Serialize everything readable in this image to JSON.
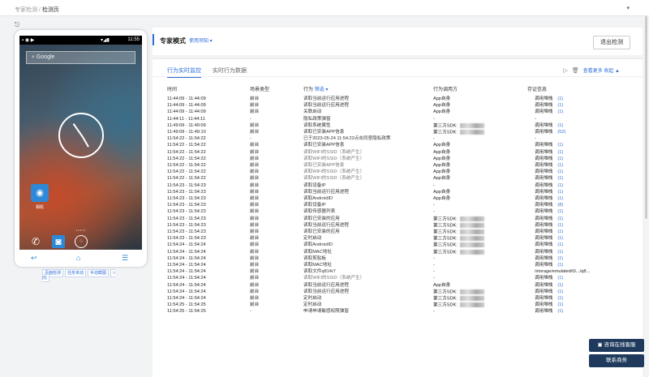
{
  "breadcrumb": {
    "parent": "专家检测",
    "sep": " / ",
    "current": "检测页"
  },
  "user": "▾",
  "phone": {
    "time": "11:55",
    "search": "Google",
    "app_label": "相机",
    "tools": [
      "页面检测",
      "任务未动",
      "手动截图",
      "□ [0]"
    ]
  },
  "header": {
    "mode": "专家模式",
    "howto": "使用须知 ▾",
    "exit": "退出检测"
  },
  "tabs": {
    "active": "行为实时监控",
    "other": "实时行为数据",
    "more": "查看更多",
    "collapse": "收起 ▲"
  },
  "table_header": {
    "time": "时间",
    "scene": "场景类型",
    "behavior": "行为",
    "filter": "筛选 ▾",
    "caller": "行为调用方",
    "evidence": "存证信息"
  },
  "rows": [
    {
      "t": "11:44:09 - 11:44:09",
      "s": "前台",
      "b": "读取当前运行应用进程",
      "c": "App自身",
      "e": "调用堆栈",
      "n": "(1)"
    },
    {
      "t": "11:44:09 - 11:44:09",
      "s": "前台",
      "b": "读取当前运行应用进程",
      "c": "App自身",
      "e": "调用堆栈",
      "n": "(1)"
    },
    {
      "t": "11:44:09 - 11:44:09",
      "s": "前台",
      "b": "关联启动",
      "c": "App自身",
      "e": "调用堆栈",
      "n": "(1)"
    },
    {
      "t": "11:44:11 - 11:44:11",
      "s": "-",
      "b": "隐私政策弹窗",
      "c": "-",
      "e": "-",
      "n": ""
    },
    {
      "t": "11:49:09 - 11:49:09",
      "s": "前台",
      "b": "读取系统属性",
      "c": "第三方SDK:",
      "e": "调用堆栈",
      "n": "(1)"
    },
    {
      "t": "11:49:09 - 11:49:10",
      "s": "前台",
      "b": "读取已安装APP信息",
      "c": "第三方SDK:",
      "e": "调用堆栈",
      "n": "(52)"
    },
    {
      "t": "11:54:22 - 11:54:22",
      "s": "-",
      "b": "已于2023-05-24 11:54:22点击同意隐私政策",
      "c": "-",
      "e": "-",
      "n": ""
    },
    {
      "t": "11:54:22 - 11:54:22",
      "s": "前台",
      "b": "读取已安装APP信息",
      "c": "App自身",
      "e": "调用堆栈",
      "n": "(1)"
    },
    {
      "t": "11:54:22 - 11:54:22",
      "s": "前台",
      "b": "读取WIFI的SSID（系统产生）",
      "c": "App自身",
      "e": "调用堆栈",
      "n": "(1)"
    },
    {
      "t": "11:54:22 - 11:54:22",
      "s": "前台",
      "b": "读取WIFI的SSID（系统产生）",
      "c": "App自身",
      "e": "调用堆栈",
      "n": "(1)"
    },
    {
      "t": "11:54:22 - 11:54:22",
      "s": "前台",
      "b": "读取已安装APP信息",
      "c": "App自身",
      "e": "调用堆栈",
      "n": "(1)"
    },
    {
      "t": "11:54:22 - 11:54:22",
      "s": "前台",
      "b": "读取WIFI的SSID（系统产生）",
      "c": "App自身",
      "e": "调用堆栈",
      "n": "(1)"
    },
    {
      "t": "11:54:22 - 11:54:22",
      "s": "前台",
      "b": "读取WIFI的SSID（系统产生）",
      "c": "App自身",
      "e": "调用堆栈",
      "n": "(1)"
    },
    {
      "t": "11:54:23 - 11:54:23",
      "s": "前台",
      "b": "读取设备IP",
      "c": "-",
      "e": "调用堆栈",
      "n": "(1)"
    },
    {
      "t": "11:54:23 - 11:54:23",
      "s": "前台",
      "b": "读取当前运行应用进程",
      "c": "App自身",
      "e": "调用堆栈",
      "n": "(1)"
    },
    {
      "t": "11:54:23 - 11:54:23",
      "s": "前台",
      "b": "读取AndroidID",
      "c": "App自身",
      "e": "调用堆栈",
      "n": "(1)"
    },
    {
      "t": "11:54:23 - 11:54:23",
      "s": "前台",
      "b": "读取设备IP",
      "c": "-",
      "e": "调用堆栈",
      "n": "(8)"
    },
    {
      "t": "11:54:23 - 11:54:23",
      "s": "前台",
      "b": "读取传感器列表",
      "c": "-",
      "e": "调用堆栈",
      "n": "(1)"
    },
    {
      "t": "11:54:23 - 11:54:23",
      "s": "前台",
      "b": "读取已安装的应用",
      "c": "第三方SDK:",
      "e": "调用堆栈",
      "n": "(1)"
    },
    {
      "t": "11:54:23 - 11:54:23",
      "s": "前台",
      "b": "读取当前运行应用进程",
      "c": "第三方SDK:",
      "e": "调用堆栈",
      "n": "(1)"
    },
    {
      "t": "11:54:23 - 11:54:23",
      "s": "前台",
      "b": "读取已安装的应用",
      "c": "第三方SDK:",
      "e": "调用堆栈",
      "n": "(1)"
    },
    {
      "t": "11:54:23 - 11:54:23",
      "s": "前台",
      "b": "定时启动",
      "c": "第三方SDK:",
      "e": "调用堆栈",
      "n": "(1)"
    },
    {
      "t": "11:54:24 - 11:54:24",
      "s": "前台",
      "b": "读取AndroidID",
      "c": "第三方SDK:",
      "e": "调用堆栈",
      "n": "(1)"
    },
    {
      "t": "11:54:24 - 11:54:24",
      "s": "前台",
      "b": "读取MAC地址",
      "c": "第三方SDK:",
      "e": "调用堆栈",
      "n": "(1)"
    },
    {
      "t": "11:54:24 - 11:54:24",
      "s": "前台",
      "b": "读取剪贴板",
      "c": "-",
      "e": "调用堆栈",
      "n": "(1)"
    },
    {
      "t": "11:54:24 - 11:54:24",
      "s": "前台",
      "b": "读取MAC地址",
      "c": "-",
      "e": "调用堆栈",
      "n": "(1)"
    },
    {
      "t": "11:54:24 - 11:54:24",
      "s": "前台",
      "b": "读取文件q814r7",
      "c": "-",
      "e": "/storage/emulated/0/.../q8...",
      "n": ""
    },
    {
      "t": "11:54:24 - 11:54:24",
      "s": "前台",
      "b": "读取WIFI的SSID（系统产生）",
      "c": "-",
      "e": "调用堆栈",
      "n": "(1)"
    },
    {
      "t": "11:54:24 - 11:54:24",
      "s": "前台",
      "b": "读取当前运行应用进程",
      "c": "App自身",
      "e": "调用堆栈",
      "n": "(1)"
    },
    {
      "t": "11:54:24 - 11:54:24",
      "s": "前台",
      "b": "读取当前运行应用进程",
      "c": "第三方SDK:",
      "e": "调用堆栈",
      "n": "(1)"
    },
    {
      "t": "11:54:24 - 11:54:24",
      "s": "前台",
      "b": "定时启动",
      "c": "第三方SDK:",
      "e": "调用堆栈",
      "n": "(1)"
    },
    {
      "t": "11:54:25 - 11:54:25",
      "s": "前台",
      "b": "定时启动",
      "c": "第三方SDK:",
      "e": "调用堆栈",
      "n": "(1)"
    },
    {
      "t": "11:54:25 - 11:54:25",
      "s": "-",
      "b": "申请申请敏感权限弹窗",
      "c": "-",
      "e": "调用堆栈",
      "n": "(1)"
    }
  ],
  "buttons": {
    "service": "咨询在线客服",
    "contact": "联系商务"
  }
}
